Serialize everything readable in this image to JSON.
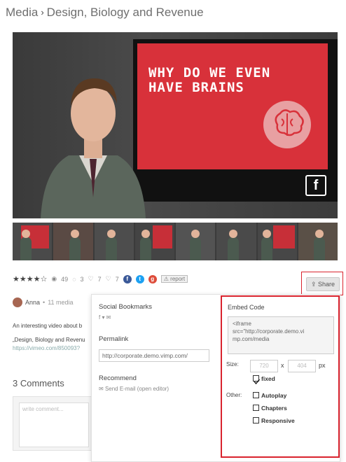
{
  "breadcrumb": {
    "root": "Media",
    "separator": "›",
    "current": "Design, Biology and Revenue"
  },
  "video": {
    "screen_text": "WHY DO WE EVEN HAVE BRAINS",
    "badge": "f",
    "screen_color": "#d8313a"
  },
  "thumbnails": [
    "thumb-1",
    "thumb-2",
    "thumb-3",
    "thumb-4",
    "thumb-5",
    "thumb-6",
    "thumb-7",
    "thumb-8"
  ],
  "meta": {
    "stars": "★★★★☆",
    "views": "49",
    "comments": "3",
    "likes": "7",
    "dislikes": "7",
    "report_label": "report"
  },
  "share": {
    "button_label": "Share"
  },
  "author": {
    "name": "Anna",
    "sub": "11 media"
  },
  "description": {
    "line1": "An interesting video about b",
    "line2": "„Design, Biology and Revenu",
    "line3": "https://vimeo.com/850093?"
  },
  "comments": {
    "heading": "3 Comments",
    "placeholder": "write comment..."
  },
  "popup": {
    "social_title": "Social Bookmarks",
    "social_icons": "f ▾ ✉",
    "permalink_title": "Permalink",
    "permalink_value": "http://corporate.demo.vimp.com/",
    "recommend_title": "Recommend",
    "recommend_link": "Send E-mail (open editor)"
  },
  "embed": {
    "title": "Embed Code",
    "code_line1": "<iframe",
    "code_line2": "src=\"http://corporate.demo.vi",
    "code_line3": "mp.com/media",
    "size_label": "Size:",
    "width": "720",
    "x": "x",
    "height": "404",
    "unit": "px",
    "fixed_label": "fixed",
    "other_label": "Other:",
    "autoplay_label": "Autoplay",
    "chapters_label": "Chapters",
    "responsive_label": "Responsive"
  },
  "colors": {
    "accent_red": "#d9232e",
    "facebook_blue": "#3b5998",
    "twitter_blue": "#1da1f2"
  }
}
